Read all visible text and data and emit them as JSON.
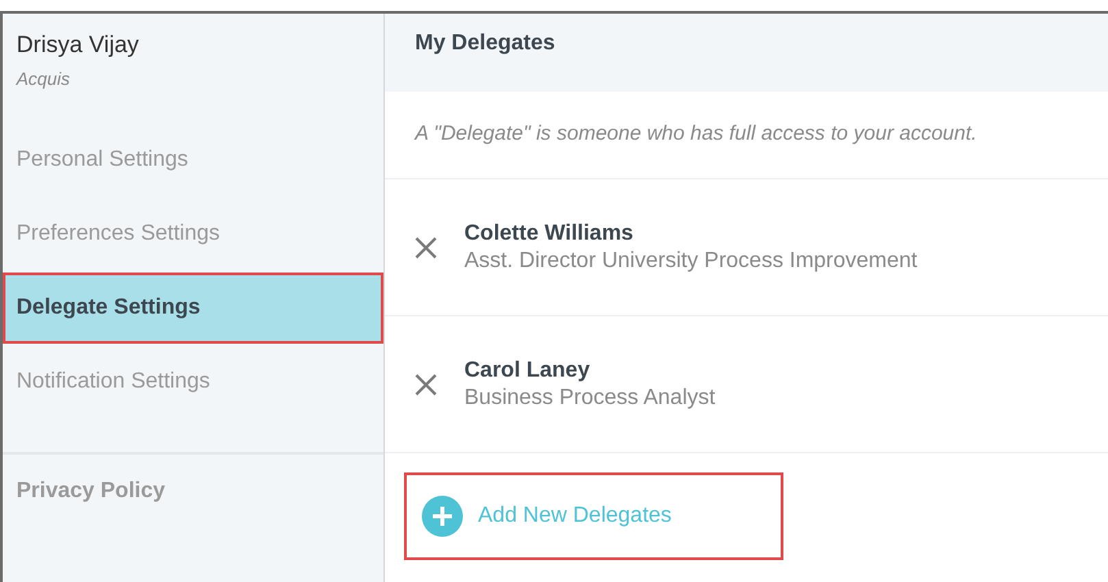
{
  "user": {
    "name": "Drisya Vijay",
    "organization": "Acquis"
  },
  "sidebar": {
    "items": [
      {
        "label": "Personal Settings",
        "selected": false,
        "annotated": false
      },
      {
        "label": "Preferences Settings",
        "selected": false,
        "annotated": false
      },
      {
        "label": "Delegate Settings",
        "selected": true,
        "annotated": true
      },
      {
        "label": "Notification Settings",
        "selected": false,
        "annotated": false
      }
    ],
    "footer_link": "Privacy Policy"
  },
  "panel": {
    "title": "My Delegates",
    "description": "A \"Delegate\" is someone who has full access to your account.",
    "delegates": [
      {
        "name": "Colette Williams",
        "role": "Asst. Director University Process Improvement"
      },
      {
        "name": "Carol Laney",
        "role": "Business Process Analyst"
      }
    ],
    "add_button": {
      "label": "Add New Delegates",
      "annotated": true
    }
  }
}
